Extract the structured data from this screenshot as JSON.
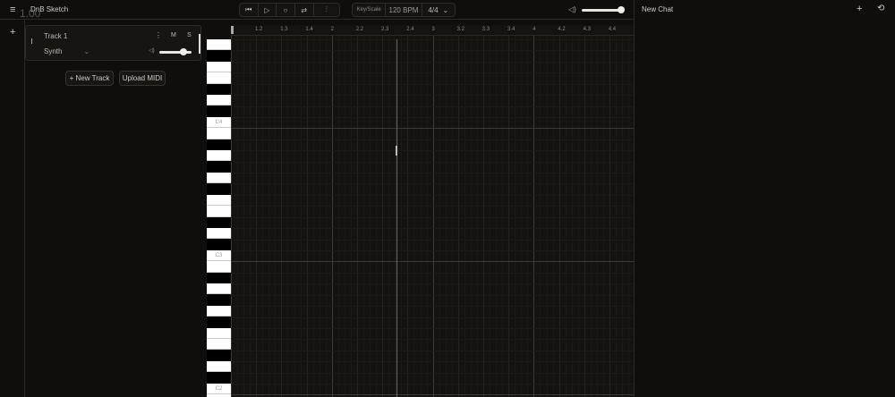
{
  "app": {
    "title": "DnB Sketch",
    "overlay_value": "1.00"
  },
  "transport": {
    "buttons": [
      {
        "icon": "skip-back-icon",
        "glyph": "⏮"
      },
      {
        "icon": "play-icon",
        "glyph": "▷"
      },
      {
        "icon": "record-icon",
        "glyph": "○"
      },
      {
        "icon": "loop-icon",
        "glyph": "⇄"
      },
      {
        "icon": "metronome-icon",
        "glyph": "⫶"
      }
    ]
  },
  "settings": {
    "key_scale": "Key/Scale",
    "bpm": "120 BPM",
    "time_signature": "4/4"
  },
  "master_volume": {
    "icon": "volume-icon",
    "glyph": "🔈",
    "value": 1.0
  },
  "track": {
    "name": "Track 1",
    "instrument": "Synth",
    "menu_glyph": "⋮",
    "mute": "M",
    "solo": "S",
    "volume": 0.85
  },
  "buttons": {
    "new_track": "+ New Track",
    "upload_midi": "Upload MIDI",
    "add": "+"
  },
  "ruler": {
    "labels": [
      "1.2",
      "1.3",
      "1.4",
      "2",
      "2.2",
      "2.3",
      "2.4",
      "3",
      "3.2",
      "3.3",
      "3.4",
      "4",
      "4.2",
      "4.3",
      "4.4"
    ]
  },
  "piano": {
    "labels": {
      "C4": "C4",
      "C3": "C3",
      "C2": "C2"
    }
  },
  "chat": {
    "title": "New Chat",
    "new_glyph": "+",
    "history_glyph": "⟲"
  }
}
